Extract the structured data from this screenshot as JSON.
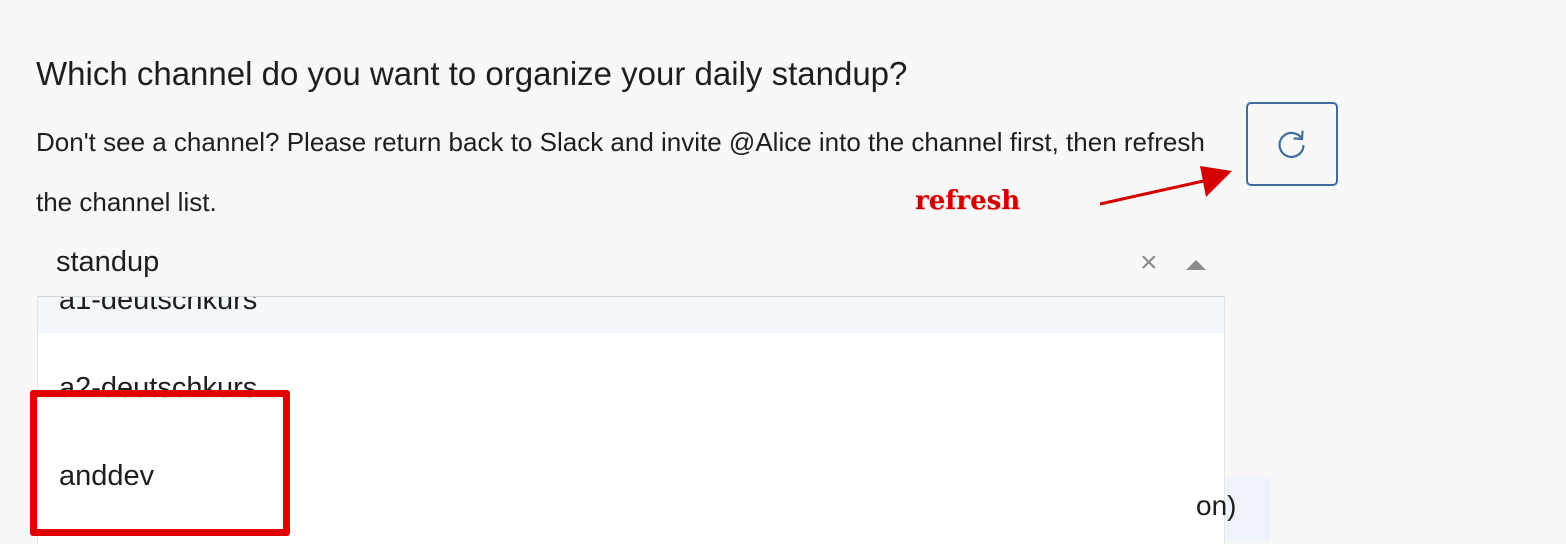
{
  "prompt": {
    "title": "Which channel do you want to organize your daily standup?",
    "description": "Don't see a channel? Please return back to Slack and invite @Alice into the channel first, then refresh the channel list."
  },
  "refresh_button": {
    "icon": "refresh-icon",
    "color": "#3f6e9a"
  },
  "annotation": {
    "label": "refresh",
    "color": "#d10000"
  },
  "select": {
    "value": "standup",
    "clear_icon": "×",
    "options": [
      "a1-deutschkurs",
      "a2-deutschkurs",
      "anddev"
    ]
  },
  "background_fragment": {
    "text": "on)"
  },
  "highlight": {
    "color": "#e00000"
  }
}
